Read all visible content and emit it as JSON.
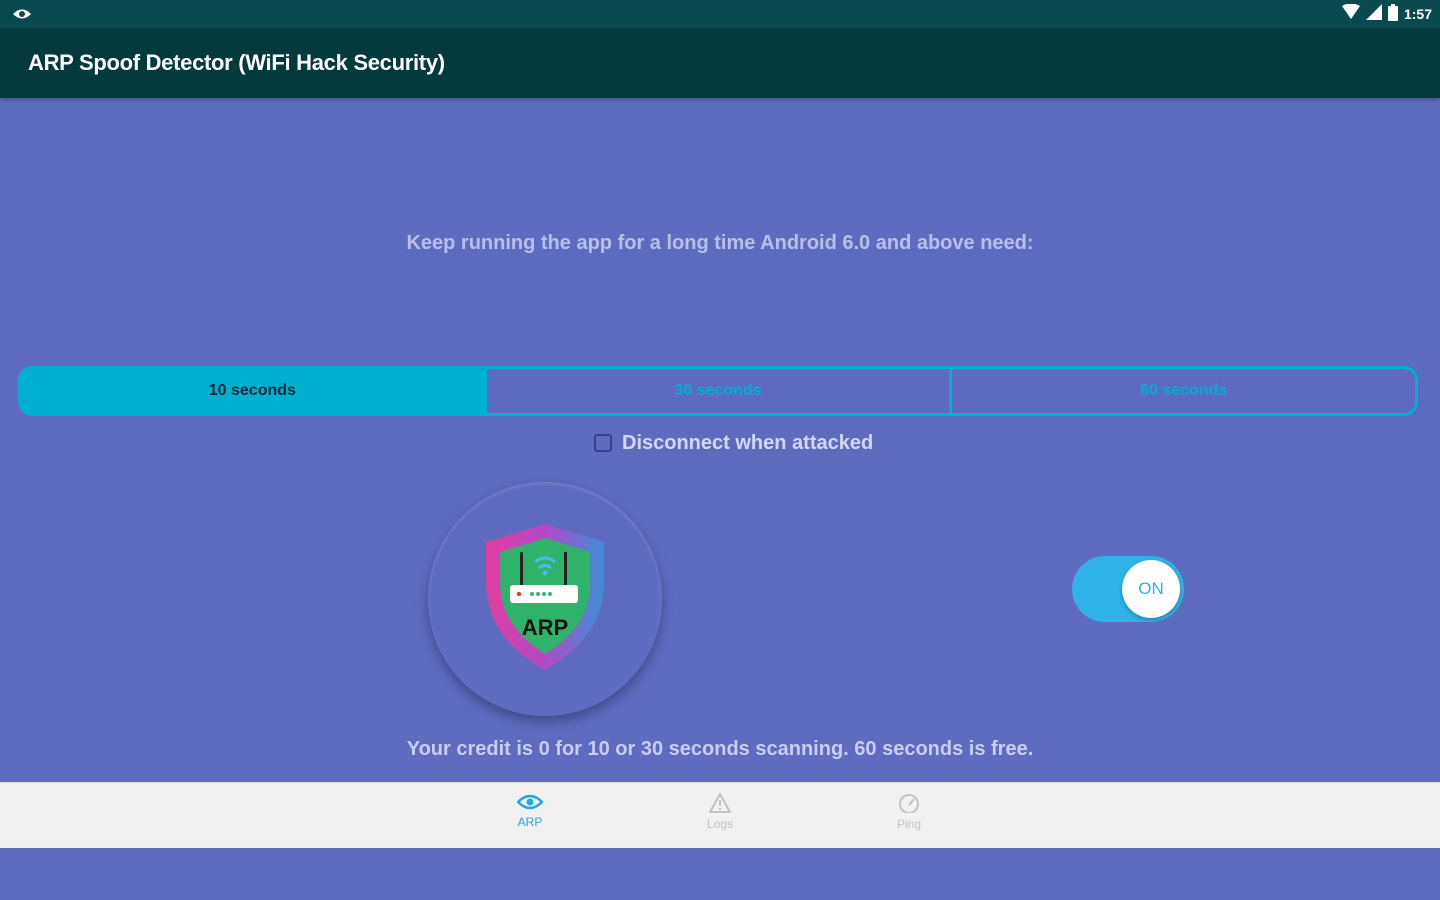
{
  "status_bar": {
    "time": "1:57"
  },
  "app_bar": {
    "title": "ARP Spoof Detector (WiFi Hack Security)"
  },
  "notice": "Keep running the app for a long time Android 6.0 and above need:",
  "scan_interval": {
    "options": [
      {
        "label": "10 seconds",
        "selected": true
      },
      {
        "label": "30 seconds",
        "selected": false
      },
      {
        "label": "60 seconds",
        "selected": false
      }
    ]
  },
  "disconnect": {
    "label": "Disconnect when attacked",
    "checked": false
  },
  "shield": {
    "badge_text": "ARP"
  },
  "toggle": {
    "label": "ON",
    "state": true
  },
  "credit_text": "Your credit is 0 for 10 or 30 seconds scanning. 60 seconds is free.",
  "bottom_nav": {
    "items": [
      {
        "label": "ARP",
        "icon": "eye-icon",
        "active": true
      },
      {
        "label": "Logs",
        "icon": "warning-icon",
        "active": false
      },
      {
        "label": "Ping",
        "icon": "speedometer-icon",
        "active": false
      }
    ]
  },
  "colors": {
    "background": "#5f6bbf",
    "app_bar": "#043a3b",
    "status_bar": "#0a4a4f",
    "accent": "#00b0d0",
    "toggle": "#2fb2e6"
  }
}
